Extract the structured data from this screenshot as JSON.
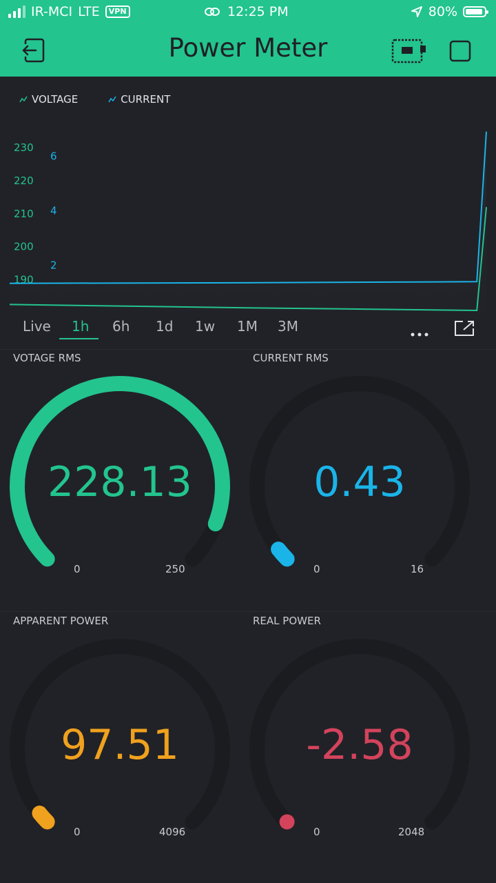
{
  "status": {
    "carrier": "IR-MCI",
    "network": "LTE",
    "vpn": "VPN",
    "time": "12:25 PM",
    "battery": "80%"
  },
  "header": {
    "title": "Power Meter",
    "icons": [
      "exit-icon",
      "device-board-icon",
      "stop-square-icon"
    ]
  },
  "chart": {
    "legend": [
      "VOLTAGE",
      "CURRENT"
    ],
    "tabs": [
      "Live",
      "1h",
      "6h",
      "1d",
      "1w",
      "1M",
      "3M"
    ],
    "active_tab": "1h"
  },
  "chart_data": {
    "type": "line",
    "series": [
      {
        "name": "VOLTAGE",
        "color": "#23c48e",
        "axis": "left",
        "points": [
          [
            0,
            182.5
          ],
          [
            0.5,
            181.5
          ],
          [
            0.98,
            180.7
          ],
          [
            1.0,
            212.0
          ]
        ]
      },
      {
        "name": "CURRENT",
        "color": "#1ab4e8",
        "axis": "right",
        "points": [
          [
            0,
            1.34
          ],
          [
            0.5,
            1.36
          ],
          [
            0.98,
            1.4
          ],
          [
            1.0,
            6.9
          ]
        ]
      }
    ],
    "left_axis": {
      "ticks": [
        "230",
        "220",
        "210",
        "200",
        "190"
      ],
      "range": [
        180.5,
        239
      ]
    },
    "right_axis": {
      "ticks": [
        "6",
        "4",
        "2"
      ],
      "range": [
        0.32,
        7.4
      ]
    }
  },
  "gauges": [
    {
      "label": "VOTAGE RMS",
      "value": "228.13",
      "min": "0",
      "max": "250",
      "fraction": 0.9125,
      "color": "#23c48e"
    },
    {
      "label": "CURRENT RMS",
      "value": "0.43",
      "min": "0",
      "max": "16",
      "fraction": 0.027,
      "color": "#1ab4e8"
    },
    {
      "label": "APPARENT POWER",
      "value": "97.51",
      "min": "0",
      "max": "4096",
      "fraction": 0.024,
      "color": "#f0a11e"
    },
    {
      "label": "REAL POWER",
      "value": "-2.58",
      "min": "0",
      "max": "2048",
      "fraction": 0.0,
      "color": "#d3435c"
    }
  ]
}
